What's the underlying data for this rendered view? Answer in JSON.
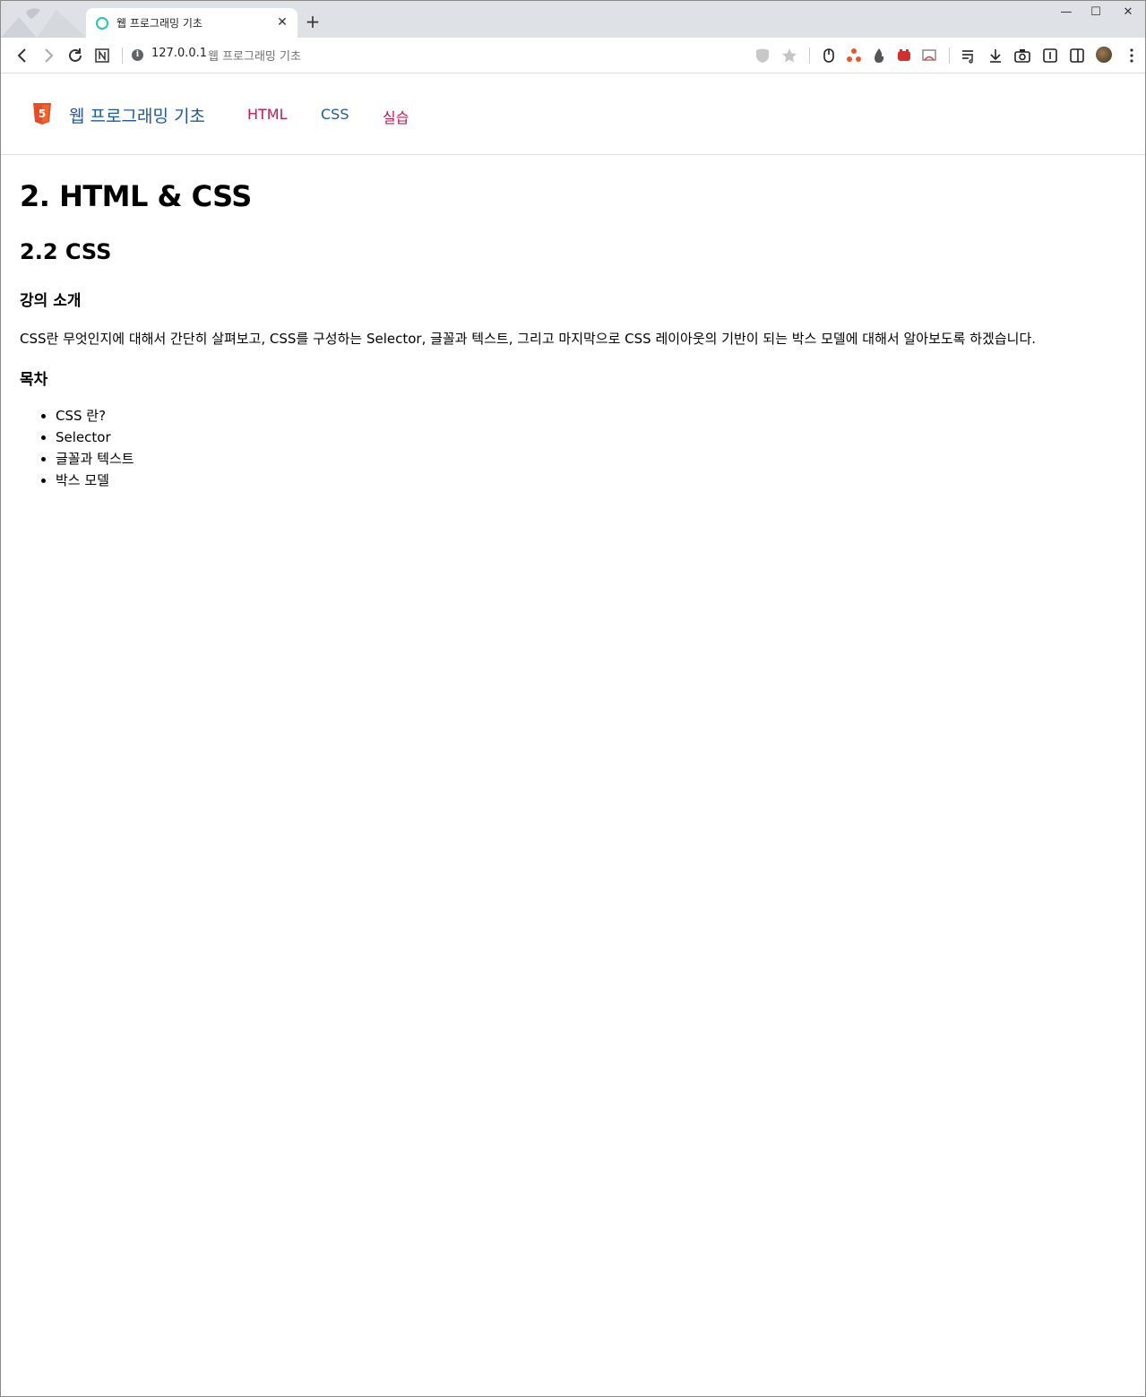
{
  "browser": {
    "tab": {
      "title": "웹 프로그래밍 기초",
      "close": "✕"
    },
    "new_tab": "+",
    "window_controls": {
      "minimize": "—",
      "maximize": "☐",
      "close": "✕"
    },
    "address": {
      "host": "127.0.0.1",
      "page_title": "웹 프로그래밍 기초"
    }
  },
  "site": {
    "brand": "웹 프로그래밍 기초",
    "logo_text": "5",
    "nav": [
      {
        "label": "HTML",
        "color": "#c2185b"
      },
      {
        "label": "CSS",
        "color": "#1e5a9b"
      },
      {
        "label": "실습",
        "color": "#c2185b"
      }
    ]
  },
  "content": {
    "h1": "2. HTML & CSS",
    "h2": "2.2 CSS",
    "intro_heading": "강의 소개",
    "intro_text": "CSS란 무엇인지에 대해서 간단히 살펴보고, CSS를 구성하는 Selector, 글꼴과 텍스트, 그리고 마지막으로 CSS 레이아웃의 기반이 되는 박스 모델에 대해서 알아보도록 하겠습니다.",
    "toc_heading": "목차",
    "toc": [
      "CSS 란?",
      "Selector",
      "글꼴과 텍스트",
      "박스 모델"
    ]
  },
  "colors": {
    "brand": "#1e5a9b",
    "accent": "#c2185b",
    "html5_orange": "#e44d26"
  }
}
